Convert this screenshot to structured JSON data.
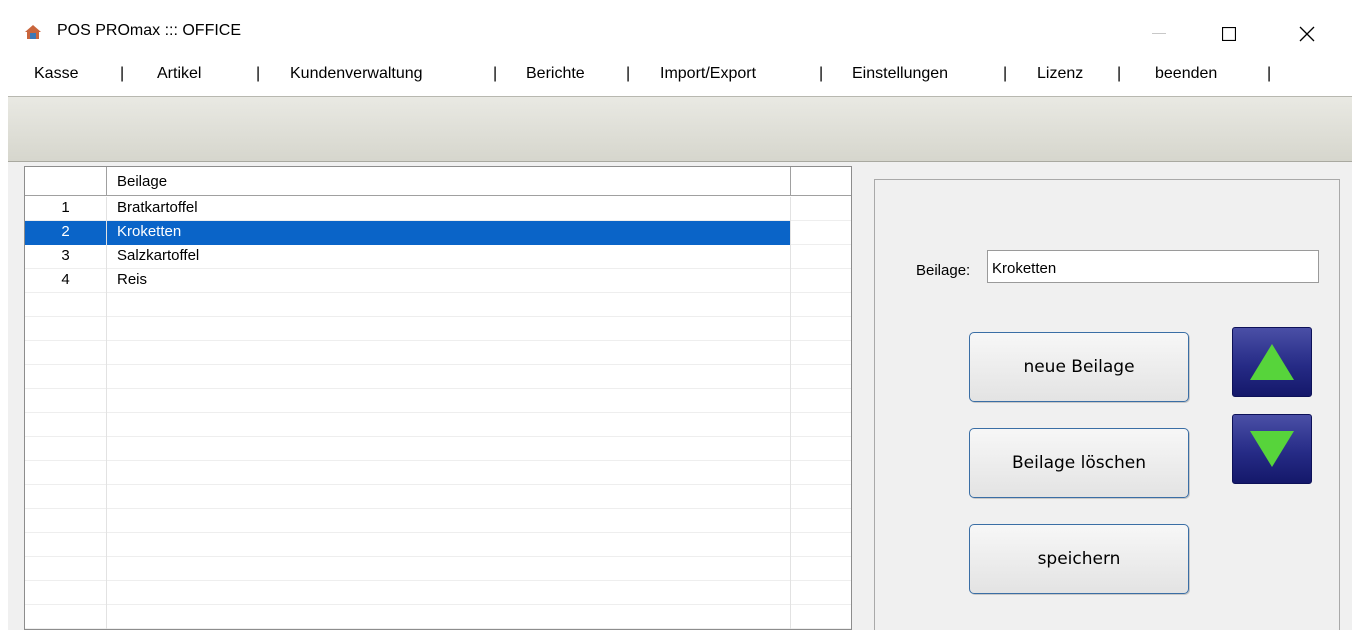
{
  "window": {
    "title": "POS PROmax ::: OFFICE",
    "icons": {
      "app": "house-icon",
      "minimize": "minimize-icon",
      "maximize": "maximize-icon",
      "close": "close-icon"
    }
  },
  "menu": {
    "items": [
      "Kasse",
      "Artikel",
      "Kundenverwaltung",
      "Berichte",
      "Import/Export",
      "Einstellungen",
      "Lizenz",
      "beenden"
    ],
    "separator": "|"
  },
  "grid": {
    "columns": [
      "",
      "Beilage",
      ""
    ],
    "rows": [
      {
        "num": "1",
        "name": "Bratkartoffel"
      },
      {
        "num": "2",
        "name": "Kroketten"
      },
      {
        "num": "3",
        "name": "Salzkartoffel"
      },
      {
        "num": "4",
        "name": "Reis"
      }
    ],
    "selected_index": 1
  },
  "form": {
    "label": "Beilage:",
    "value": "Kroketten"
  },
  "buttons": {
    "new": "neue Beilage",
    "delete": "Beilage löschen",
    "save": "speichern",
    "up_icon": "arrow-up-icon",
    "down_icon": "arrow-down-icon"
  },
  "colors": {
    "selection": "#0a64c8",
    "arrow_fill": "#57d43b",
    "arrow_button": "#262b86"
  }
}
